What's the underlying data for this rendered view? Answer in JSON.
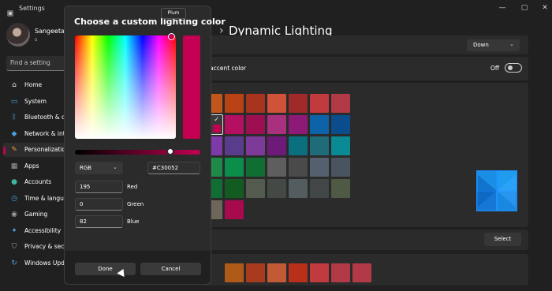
{
  "window": {
    "app_title": "Settings",
    "minimize_icon": "minimize-icon",
    "maximize_icon": "maximize-icon",
    "close_icon": "close-icon"
  },
  "sidebar": {
    "user_name": "Sangeeta G",
    "user_sub": "s",
    "search_placeholder": "Find a setting",
    "items": [
      {
        "label": "Home",
        "icon": "home-icon",
        "color": "#e8e8e8"
      },
      {
        "label": "System",
        "icon": "monitor-icon",
        "color": "#4aa3df"
      },
      {
        "label": "Bluetooth & devi",
        "icon": "bluetooth-icon",
        "color": "#4aa3df"
      },
      {
        "label": "Network & inter",
        "icon": "wifi-icon",
        "color": "#4aa3df"
      },
      {
        "label": "Personalization",
        "icon": "brush-icon",
        "color": "#e89a3c"
      },
      {
        "label": "Apps",
        "icon": "apps-icon",
        "color": "#9aa0a6"
      },
      {
        "label": "Accounts",
        "icon": "person-icon",
        "color": "#3cb4a0"
      },
      {
        "label": "Time & languag",
        "icon": "clock-icon",
        "color": "#4aa3df"
      },
      {
        "label": "Gaming",
        "icon": "gamepad-icon",
        "color": "#9aa0a6"
      },
      {
        "label": "Accessibility",
        "icon": "accessibility-icon",
        "color": "#4aa3df"
      },
      {
        "label": "Privacy & securi",
        "icon": "shield-icon",
        "color": "#9aa0a6"
      },
      {
        "label": "Windows Updat",
        "icon": "update-icon",
        "color": "#4aa3df"
      }
    ]
  },
  "content": {
    "breadcrumb_prev": "n",
    "page_title": "Dynamic Lighting",
    "direction_select": "Down",
    "accent_label": "accent color",
    "toggle_state": "Off",
    "select_button": "Select",
    "swatch_colors": [
      [
        "#c0561a",
        "#b84214",
        "#a8341e",
        "#d05238",
        "#a02a2a",
        "#c03a3e",
        "#b23a46"
      ],
      [
        "#a8305a",
        "#b40f60",
        "#9e0e52",
        "#a8307e",
        "#8e1a78",
        "#0e63a8",
        "#0a4c8c"
      ],
      [
        "#7e3aa8",
        "#5a3c8c",
        "#7e3a98",
        "#6e1a78",
        "#0a7080",
        "#1e6c7a",
        "#0a8a94"
      ],
      [
        "#1e8a4a",
        "#0a8e4a",
        "#106e34",
        "#5e5e5e",
        "#4a4a4a",
        "#54606e",
        "#4a5460"
      ],
      [
        "#106e34",
        "#125c22",
        "#535a4e",
        "#444946",
        "#535c5e",
        "#434646",
        "#4e5a44"
      ],
      [
        "#6e665a",
        "#a80a4e"
      ]
    ],
    "bottom_swatches": [
      "#b05a1a",
      "#a83a1e",
      "#c25a36",
      "#b8301a",
      "#c03a3e",
      "#b23a46",
      "#b23a46"
    ],
    "logo": "windows-logo-icon"
  },
  "dialog": {
    "title": "Choose a custom lighting color",
    "tooltip": "Plum",
    "color_hex": "#C30052",
    "mode": "RGB",
    "fields": [
      {
        "label": "Red",
        "value": "195"
      },
      {
        "label": "Green",
        "value": "0"
      },
      {
        "label": "Blue",
        "value": "82"
      }
    ],
    "value_slider_fraction": 0.76,
    "done_label": "Done",
    "cancel_label": "Cancel"
  }
}
